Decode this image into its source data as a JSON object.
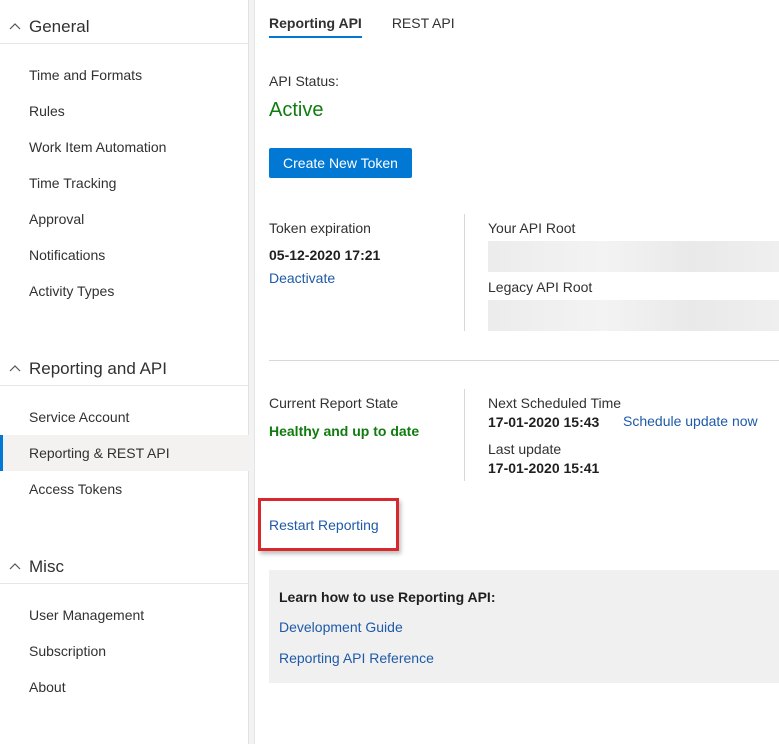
{
  "sidebar": {
    "sections": [
      {
        "title": "General",
        "items": [
          "Time and Formats",
          "Rules",
          "Work Item Automation",
          "Time Tracking",
          "Approval",
          "Notifications",
          "Activity Types"
        ]
      },
      {
        "title": "Reporting and API",
        "items": [
          "Service Account",
          "Reporting & REST API",
          "Access Tokens"
        ]
      },
      {
        "title": "Misc",
        "items": [
          "User Management",
          "Subscription",
          "About"
        ]
      }
    ],
    "active_item": "Reporting & REST API"
  },
  "tabs": [
    {
      "label": "Reporting API",
      "active": true
    },
    {
      "label": "REST API",
      "active": false
    }
  ],
  "api": {
    "status_label": "API Status:",
    "status_value": "Active",
    "create_token_label": "Create New Token",
    "token_expiration_label": "Token expiration",
    "token_expiration_value": "05-12-2020 17:21",
    "deactivate_label": "Deactivate",
    "api_root_label": "Your API Root",
    "legacy_root_label": "Legacy API Root"
  },
  "report": {
    "state_label": "Current Report State",
    "state_value": "Healthy and up to date",
    "next_label": "Next Scheduled Time",
    "next_value": "17-01-2020 15:43",
    "schedule_now_label": "Schedule update now",
    "last_label": "Last update",
    "last_value": "17-01-2020 15:41",
    "restart_label": "Restart Reporting"
  },
  "learn": {
    "title": "Learn how to use Reporting API:",
    "links": [
      "Development Guide",
      "Reporting API Reference"
    ]
  },
  "colors": {
    "accent": "#0078d4",
    "success": "#107c10",
    "link": "#1e5aa8",
    "highlight": "#d9272e"
  }
}
